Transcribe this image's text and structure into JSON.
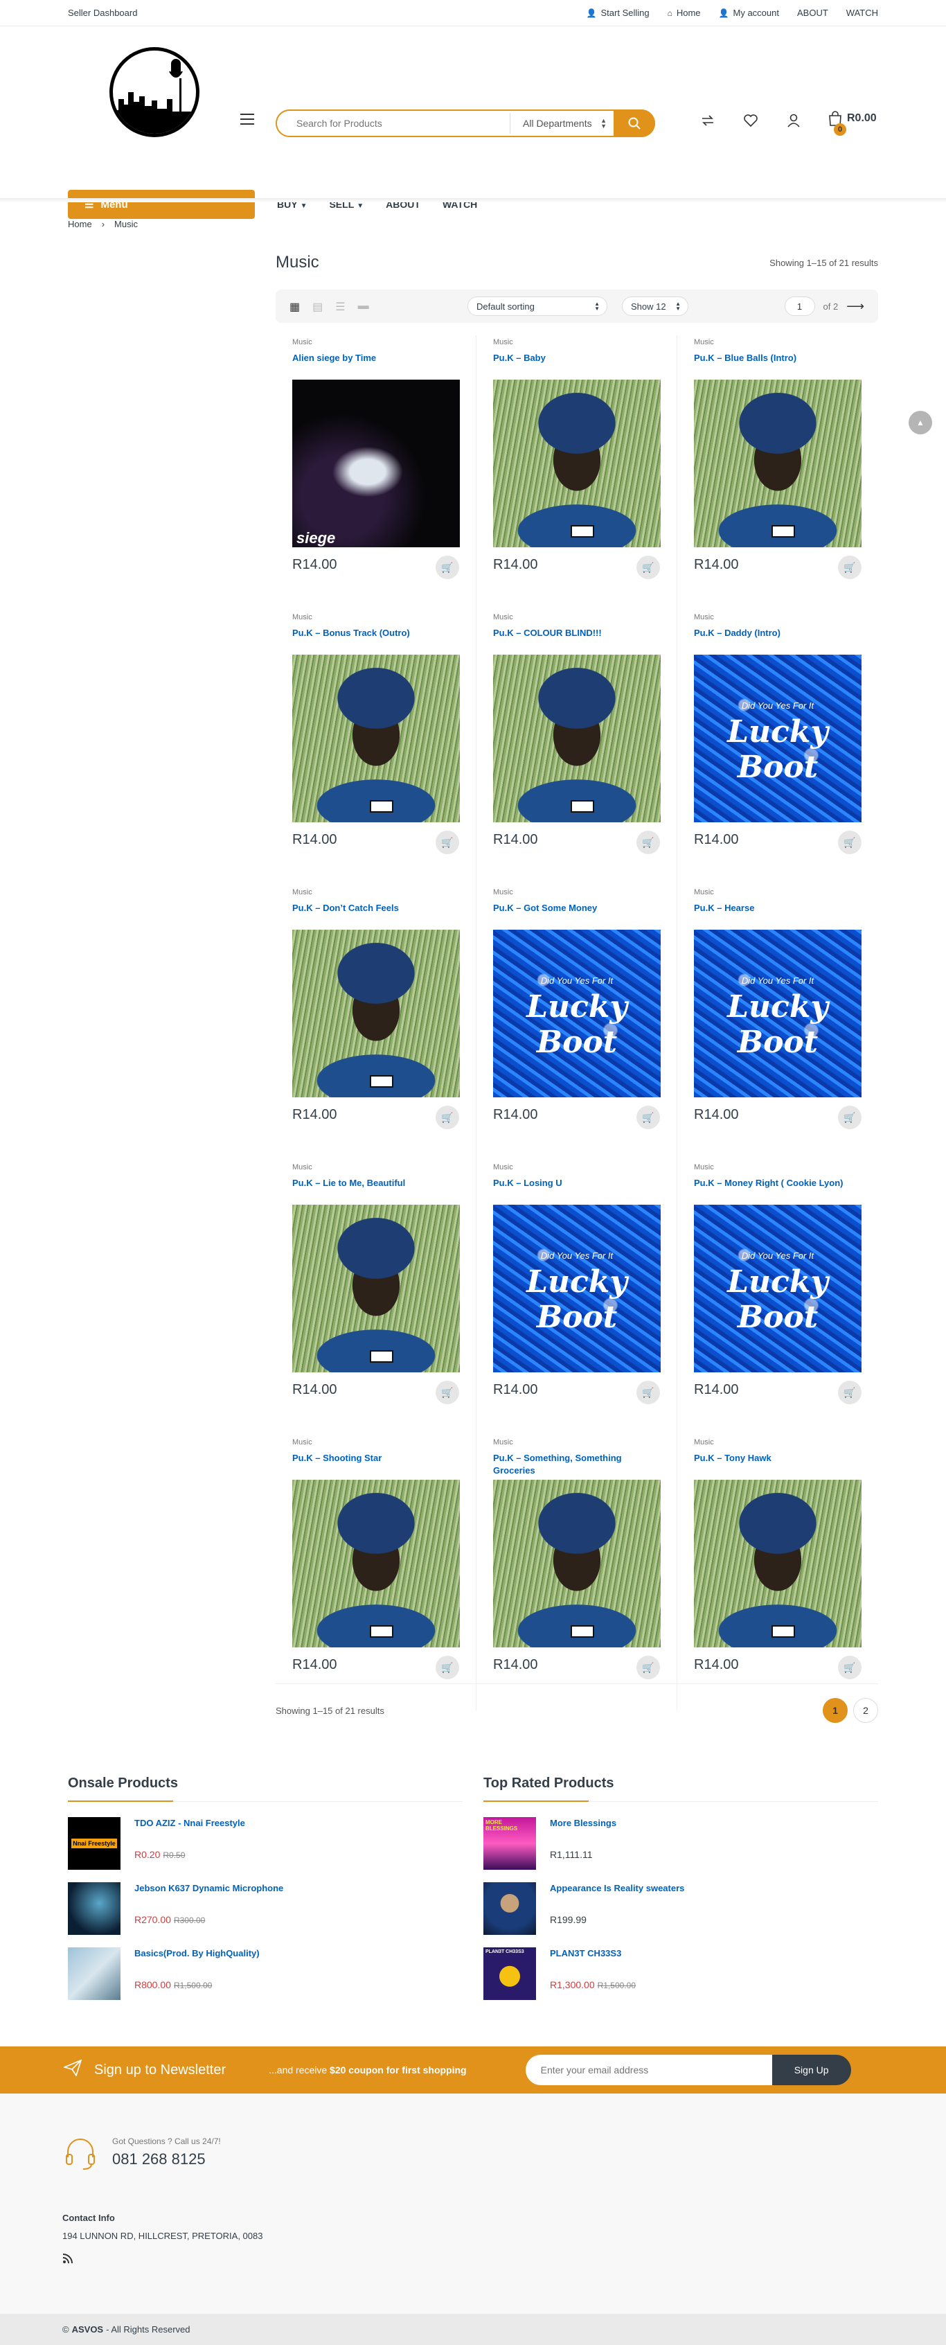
{
  "topbar": {
    "left": "Seller Dashboard",
    "links": [
      {
        "icon": "person-icon",
        "label": "Start Selling"
      },
      {
        "icon": "home-icon",
        "label": "Home"
      },
      {
        "icon": "person-icon",
        "label": "My account"
      },
      {
        "icon": "",
        "label": "ABOUT"
      },
      {
        "icon": "",
        "label": "WATCH"
      }
    ]
  },
  "search": {
    "placeholder": "Search for Products",
    "department": "All Departments"
  },
  "cart": {
    "total": "R0.00",
    "count": "0"
  },
  "menu": {
    "label": "Menu"
  },
  "nav": [
    {
      "label": "BUY",
      "has_dropdown": true
    },
    {
      "label": "SELL",
      "has_dropdown": true
    },
    {
      "label": "ABOUT",
      "has_dropdown": false
    },
    {
      "label": "WATCH",
      "has_dropdown": false
    }
  ],
  "breadcrumb": {
    "home": "Home",
    "current": "Music"
  },
  "shop": {
    "title": "Music",
    "result_count": "Showing 1–15 of 21 results",
    "sorting": "Default sorting",
    "per_page": "Show 12",
    "page_input": "1",
    "page_of": "of 2"
  },
  "products": [
    {
      "category": "Music",
      "title": "Alien siege by Time",
      "price": "R14.00",
      "art": "dark"
    },
    {
      "category": "Music",
      "title": "Pu.K – Baby",
      "price": "R14.00",
      "art": "green"
    },
    {
      "category": "Music",
      "title": "Pu.K – Blue Balls (Intro)",
      "price": "R14.00",
      "art": "green"
    },
    {
      "category": "Music",
      "title": "Pu.K – Bonus Track (Outro)",
      "price": "R14.00",
      "art": "green"
    },
    {
      "category": "Music",
      "title": "Pu.K – COLOUR BLIND!!!",
      "price": "R14.00",
      "art": "green"
    },
    {
      "category": "Music",
      "title": "Pu.K – Daddy (Intro)",
      "price": "R14.00",
      "art": "blue"
    },
    {
      "category": "Music",
      "title": "Pu.K – Don’t Catch Feels",
      "price": "R14.00",
      "art": "green"
    },
    {
      "category": "Music",
      "title": "Pu.K – Got Some Money",
      "price": "R14.00",
      "art": "blue"
    },
    {
      "category": "Music",
      "title": "Pu.K – Hearse",
      "price": "R14.00",
      "art": "blue"
    },
    {
      "category": "Music",
      "title": "Pu.K – Lie to Me, Beautiful",
      "price": "R14.00",
      "art": "green"
    },
    {
      "category": "Music",
      "title": "Pu.K – Losing U",
      "price": "R14.00",
      "art": "blue"
    },
    {
      "category": "Music",
      "title": "Pu.K – Money Right ( Cookie Lyon)",
      "price": "R14.00",
      "art": "blue"
    },
    {
      "category": "Music",
      "title": "Pu.K – Shooting Star",
      "price": "R14.00",
      "art": "green"
    },
    {
      "category": "Music",
      "title": "Pu.K – Something, Something Groceries",
      "price": "R14.00",
      "art": "green"
    },
    {
      "category": "Music",
      "title": "Pu.K – Tony Hawk",
      "price": "R14.00",
      "art": "green"
    }
  ],
  "art_text": {
    "lucky_boot": "Lucky Boot",
    "lucky_boot_sub": "Did You Yes For It",
    "siege": "siege"
  },
  "bottom_pager": {
    "count": "Showing 1–15 of 21 results",
    "pages": [
      "1",
      "2"
    ],
    "current": "1"
  },
  "onsale": {
    "title": "Onsale Products",
    "items": [
      {
        "title": "TDO AZIZ - Nnai Freestyle",
        "price": "R0.20",
        "was": "R0.50",
        "thumb_text": "Nnai Freestyle"
      },
      {
        "title": "Jebson K637 Dynamic Microphone",
        "price": "R270.00",
        "was": "R300.00",
        "thumb_text": ""
      },
      {
        "title": "Basics(Prod. By HighQuality)",
        "price": "R800.00",
        "was": "R1,500.00",
        "thumb_text": ""
      }
    ]
  },
  "toprated": {
    "title": "Top Rated Products",
    "items": [
      {
        "title": "More Blessings",
        "price": "R1,111.11",
        "was": "",
        "thumb_text": "MORE BLESSINGS"
      },
      {
        "title": "Appearance Is Reality sweaters",
        "price": "R199.99",
        "was": "",
        "thumb_text": ""
      },
      {
        "title": "PLAN3T CH33S3",
        "price": "R1,300.00",
        "was": "R1,500.00",
        "thumb_text": "PLAN3T CH33S3"
      }
    ]
  },
  "newsletter": {
    "title": "Sign up to Newsletter",
    "sub_prefix": "...and receive ",
    "sub_bold": "$20 coupon for first shopping",
    "placeholder": "Enter your email address",
    "button": "Sign Up"
  },
  "footer": {
    "call_sub": "Got Questions ? Call us 24/7!",
    "phone": "081 268 8125",
    "contact_heading": "Contact Info",
    "address": "194 LUNNON RD, HILLCREST, PRETORIA, 0083",
    "copyright_prefix": "©",
    "copyright_brand": "ASVOS",
    "copyright_suffix": "- All Rights Reserved"
  },
  "colors": {
    "accent": "#e0921b",
    "link": "#0062bd",
    "sale": "#df3737",
    "dark": "#333e48"
  }
}
